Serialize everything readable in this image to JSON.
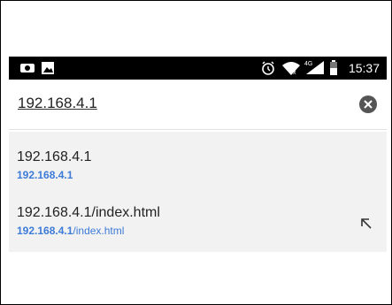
{
  "status_bar": {
    "time": "15:37",
    "network": "4G",
    "icons": [
      "notification-app-icon",
      "image-icon",
      "alarm-icon",
      "wifi-icon",
      "signal-icon",
      "battery-icon"
    ]
  },
  "address_bar": {
    "value": "192.168.4.1",
    "clear_icon": "clear-circle-icon"
  },
  "suggestions": [
    {
      "title": "192.168.4.1",
      "url_host": "192.168.4.1",
      "url_path": ""
    },
    {
      "title": "192.168.4.1/index.html",
      "url_host": "192.168.4.1",
      "url_path": "/index.html",
      "action_icon": "insert-arrow-icon"
    }
  ],
  "colors": {
    "link": "#3d7bd8",
    "status_bar_bg": "#000000",
    "suggestions_bg": "#f2f2f2"
  }
}
